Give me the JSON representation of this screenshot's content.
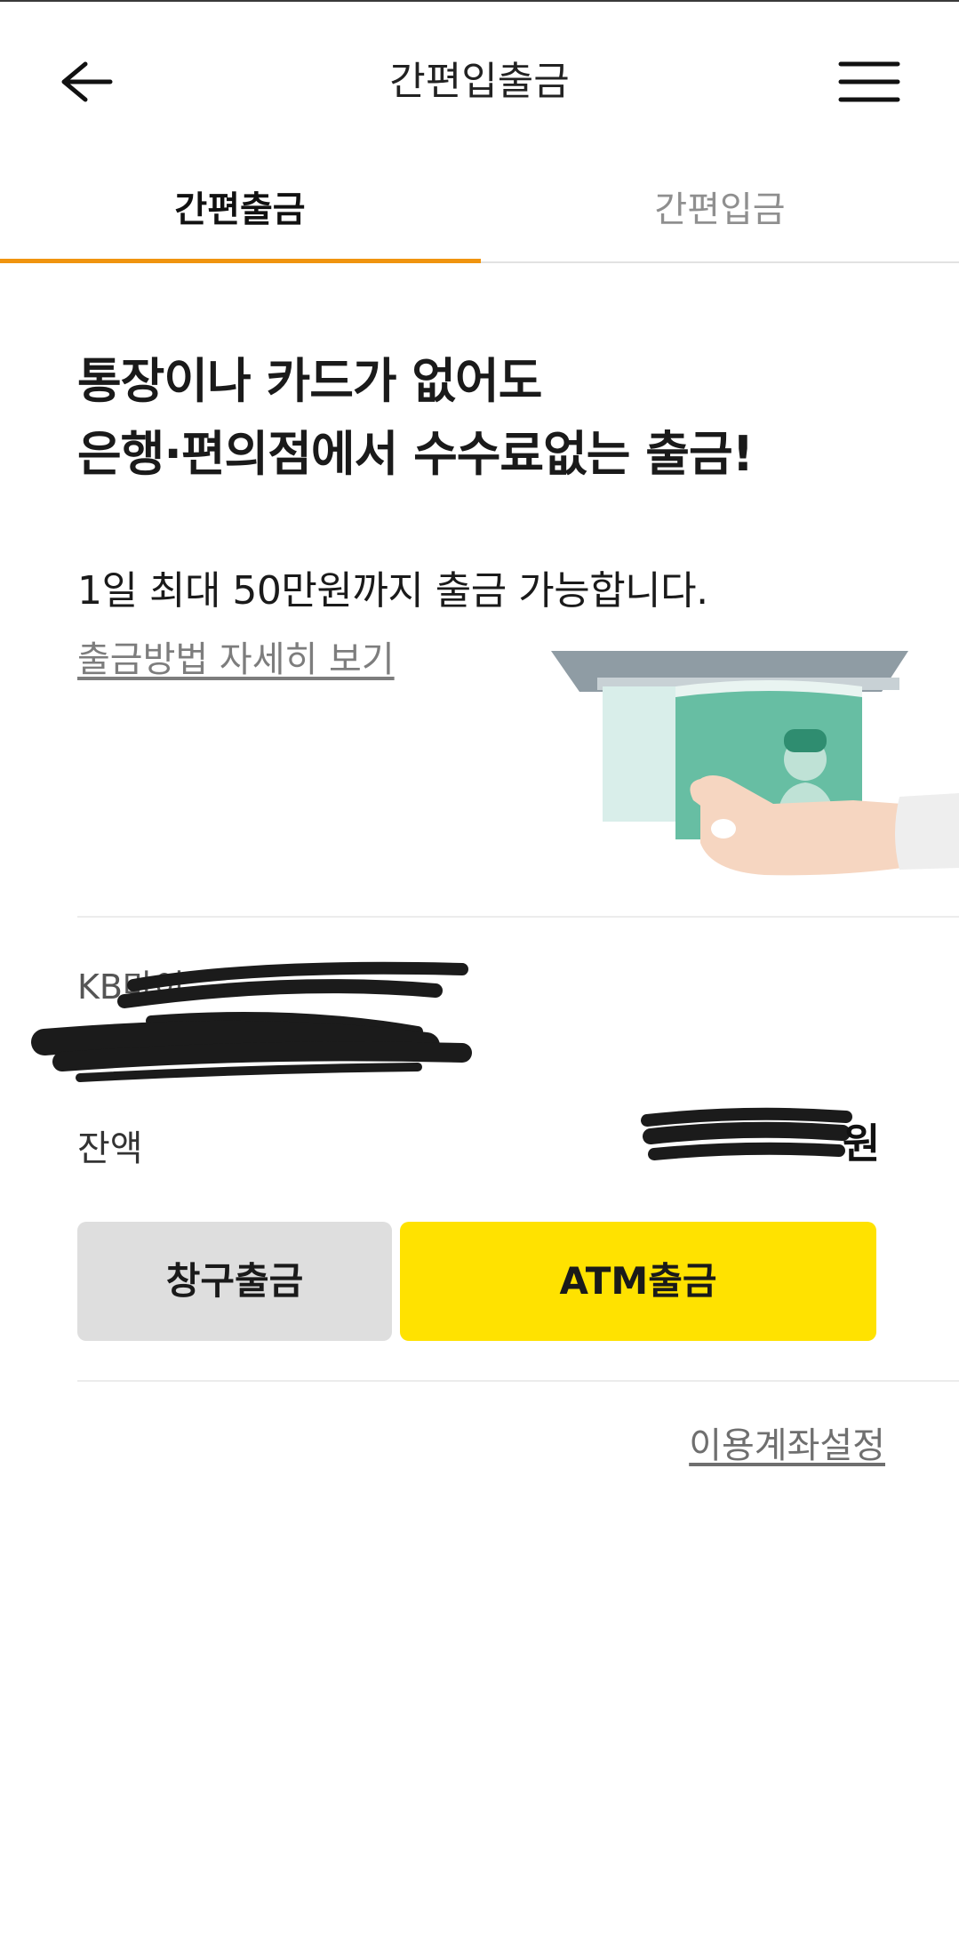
{
  "header": {
    "title": "간편입출금",
    "back_icon": "arrow-left-icon",
    "menu_icon": "hamburger-menu-icon"
  },
  "tabs": [
    {
      "label": "간편출금",
      "selected": true
    },
    {
      "label": "간편입금",
      "selected": false
    }
  ],
  "hero": {
    "headline_line1": "통장이나 카드가 없어도",
    "headline_line2": "은행·편의점에서 수수료없는 출금!",
    "limit_text": "1일 최대 50만원까지 출금 가능합니다.",
    "detail_link": "출금방법 자세히 보기"
  },
  "account": {
    "name": "KB마이",
    "number": "",
    "balance_label": "잔액",
    "balance_unit": "원"
  },
  "actions": {
    "counter_withdraw": "창구출금",
    "atm_withdraw": "ATM출금"
  },
  "footer": {
    "account_settings_link": "이용계좌설정"
  },
  "colors": {
    "tab_indicator": "#f0940f",
    "atm_button": "#ffe200",
    "counter_button": "#dedede",
    "cash_green": "#67bea3"
  }
}
